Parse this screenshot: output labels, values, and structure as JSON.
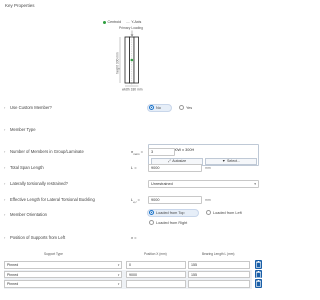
{
  "page": {
    "title": "Key Properties"
  },
  "diagram": {
    "legend": [
      {
        "label": "Centroid",
        "color": "#2e9e3f"
      },
      {
        "label": "Y-Axis",
        "color": "#9a9a9a"
      }
    ],
    "primary_loading": "Primary Loading",
    "height_label": "height 300 mm",
    "width_label": "width 180 mm"
  },
  "form": {
    "use_custom_member": {
      "label": "Use Custom Member?",
      "options": [
        "No",
        "Yes"
      ],
      "selected": "No"
    },
    "member_type": {
      "label": "Member Type",
      "value": "Kerto-S LVL 90W x 300H",
      "autosize_label": "Autosize",
      "select_label": "Select..."
    },
    "num_members": {
      "label": "Number of Members in Group/Laminate",
      "symbol": "n",
      "symbol_sub": "mem",
      "value": "3"
    },
    "span_length": {
      "label": "Total Span Length",
      "symbol": "L",
      "value": "9000",
      "unit": "mm"
    },
    "lateral_restraint": {
      "label": "Laterally torsionally restrained?",
      "value": "Unrestrained"
    },
    "effective_length": {
      "label": "Effective Length for Lateral Torsional Buckling",
      "symbol": "L",
      "symbol_sub": "e,t",
      "value": "9000",
      "unit": "mm"
    },
    "member_orientation": {
      "label": "Member Orientation",
      "options": [
        "Loaded from Top",
        "Loaded from Left",
        "Loaded from Right"
      ],
      "selected": "Loaded from Top"
    },
    "supports_position": {
      "label": "Position of Supports from Left",
      "symbol": "x"
    }
  },
  "supports_table": {
    "headers": [
      "Support Type",
      "Position X (mm)",
      "Bearing Length L (mm)"
    ],
    "rows": [
      {
        "type": "Pinned",
        "position": "0",
        "bearing": "155"
      },
      {
        "type": "Pinned",
        "position": "9000",
        "bearing": "155"
      },
      {
        "type": "Pinned",
        "position": "",
        "bearing": ""
      }
    ]
  }
}
